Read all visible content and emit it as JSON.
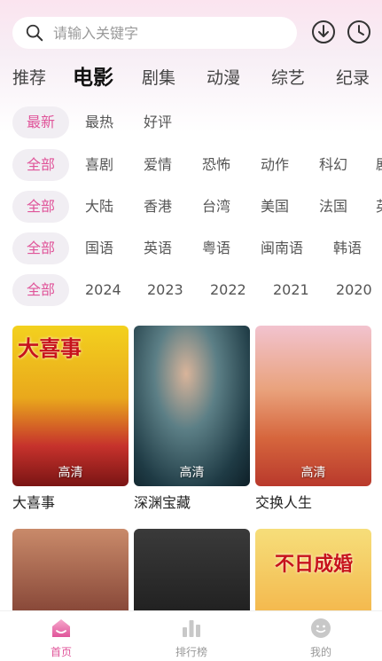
{
  "search": {
    "placeholder": "请输入关键字"
  },
  "header_icons": {
    "download": "download-icon",
    "history": "clock-icon"
  },
  "tabs": [
    {
      "label": "推荐",
      "active": false
    },
    {
      "label": "电影",
      "active": true
    },
    {
      "label": "剧集",
      "active": false
    },
    {
      "label": "动漫",
      "active": false
    },
    {
      "label": "综艺",
      "active": false
    },
    {
      "label": "纪录",
      "active": false
    }
  ],
  "filters": {
    "sort": [
      "最新",
      "最热",
      "好评"
    ],
    "genre": [
      "全部",
      "喜剧",
      "爱情",
      "恐怖",
      "动作",
      "科幻",
      "剧"
    ],
    "region": [
      "全部",
      "大陆",
      "香港",
      "台湾",
      "美国",
      "法国",
      "英"
    ],
    "language": [
      "全部",
      "国语",
      "英语",
      "粤语",
      "闽南语",
      "韩语"
    ],
    "year": [
      "全部",
      "2024",
      "2023",
      "2022",
      "2021",
      "2020"
    ]
  },
  "movies": [
    {
      "title": "大喜事",
      "quality": "高清",
      "poster_text": "大喜事"
    },
    {
      "title": "深渊宝藏",
      "quality": "高清",
      "poster_text": ""
    },
    {
      "title": "交换人生",
      "quality": "高清",
      "poster_text": ""
    },
    {
      "title": "",
      "quality": "",
      "poster_text": ""
    },
    {
      "title": "",
      "quality": "",
      "poster_text": ""
    },
    {
      "title": "",
      "quality": "",
      "poster_text": "不日成婚"
    }
  ],
  "bottom_nav": [
    {
      "label": "首页",
      "active": true,
      "icon": "home-icon"
    },
    {
      "label": "排行榜",
      "active": false,
      "icon": "ranking-icon"
    },
    {
      "label": "我的",
      "active": false,
      "icon": "profile-icon"
    }
  ],
  "colors": {
    "accent": "#e0559a",
    "chip_bg": "#f1eef3"
  }
}
